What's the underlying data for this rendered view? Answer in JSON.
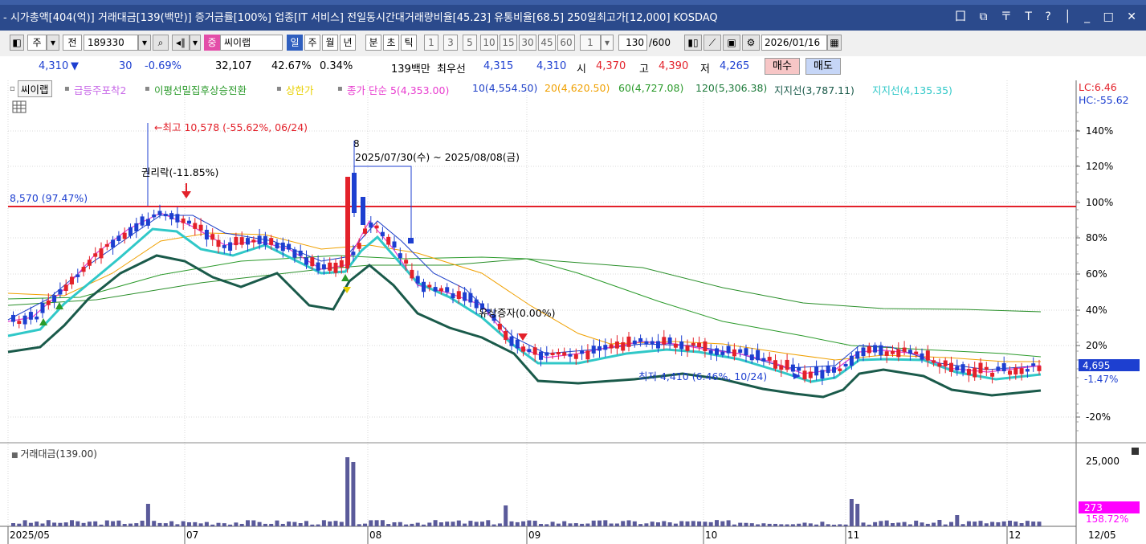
{
  "window": {
    "title": "- 시가총액[404(억)] 거래대금[139(백만)] 증거금률[100%] 업종[IT 서비스] 전일동시간대거래량비율[45.23] 유통비율[68.5] 250일최고가[12,000] KOSDAQ",
    "buttons": "囗 ⧉ 〒 T ? │ _ □ ✕"
  },
  "toolbar": {
    "market": "주",
    "all_label": "전",
    "code": "189330",
    "search_icon": "search-icon",
    "stock_name": "씨이랩",
    "stock_badge": "중",
    "periods": [
      "일",
      "주",
      "월",
      "년",
      "분",
      "초",
      "틱"
    ],
    "minutes": [
      "1",
      "3",
      "5",
      "10",
      "15",
      "30",
      "45",
      "60"
    ],
    "multiplier": "1",
    "count": "130",
    "count_total": "/600",
    "date": "2026/01/16"
  },
  "quote": {
    "price": "4,310",
    "arrow": "▼",
    "change": "30",
    "change_pct": "-0.69%",
    "volume": "32,107",
    "vol_ratio": "42.67%",
    "turnover": "0.34%",
    "trade_value": "139백만",
    "best_label": "최우선",
    "best_ask": "4,315",
    "best_bid": "4,310",
    "open_label": "시",
    "open": "4,370",
    "high_label": "고",
    "high": "4,390",
    "low_label": "저",
    "low": "4,265",
    "buy_label": "매수",
    "sell_label": "매도"
  },
  "legend": {
    "name": "씨이랩",
    "item1": "급등주포착2",
    "item2": "이평선밀집후상승전환",
    "item3": "상한가",
    "ma_title": "종가 단순 5(4,353.00)",
    "ma10": "10(4,554.50)",
    "ma20": "20(4,620.50)",
    "ma60": "60(4,727.08)",
    "ma120": "120(5,306.38)",
    "support1": "지지선(3,787.11)",
    "support2": "지지선(4,135.35)",
    "lc": "LC:6.46",
    "hc": "HC:-55.62"
  },
  "annotations": {
    "high_label": "←최고 10,578 (-55.62%, 06/24)",
    "rights_label": "권리락(-11.85%)",
    "line_label": "8,570 (97.47%)",
    "period_label": "2025/07/30(수) ~ 2025/08/08(금)",
    "period_days": "8",
    "capital_label": "유상증자(0.00%)",
    "low_label": "최저 4,410 (6.46%, 10/24)",
    "price_tag": "4,695",
    "price_tag_pct": "-1.47%",
    "vol_title": "거래대금(139.00)",
    "vol_axis_top": "25,000",
    "vol_tag": "273",
    "vol_tag_pct": "158.72%",
    "date_corner": "12/05"
  },
  "chart_data": {
    "type": "candlestick",
    "yaxis_percent_ticks": [
      "140%",
      "120%",
      "100%",
      "80%",
      "60%",
      "40%",
      "20%",
      "-20%"
    ],
    "x_ticks": [
      "2025/05",
      "07",
      "08",
      "09",
      "10",
      "11",
      "12"
    ],
    "reference_line_price": 8570,
    "series": [
      {
        "name": "5",
        "color": "#e83ccf"
      },
      {
        "name": "10",
        "color": "#1d3fc8"
      },
      {
        "name": "20",
        "color": "#f0a000"
      },
      {
        "name": "60",
        "color": "#2a9a2a"
      },
      {
        "name": "120",
        "color": "#2a8f2a"
      },
      {
        "name": "지지선(3,787.11)",
        "color": "#1a5a4a"
      },
      {
        "name": "지지선(4,135.35)",
        "color": "#30c8c8"
      }
    ],
    "volume_note": "거래대금 bars per day"
  },
  "colors": {
    "up": "#e3212a",
    "down": "#1d3fd0",
    "title_bg": "#2b4a8c",
    "ref_line": "#e3212a"
  }
}
